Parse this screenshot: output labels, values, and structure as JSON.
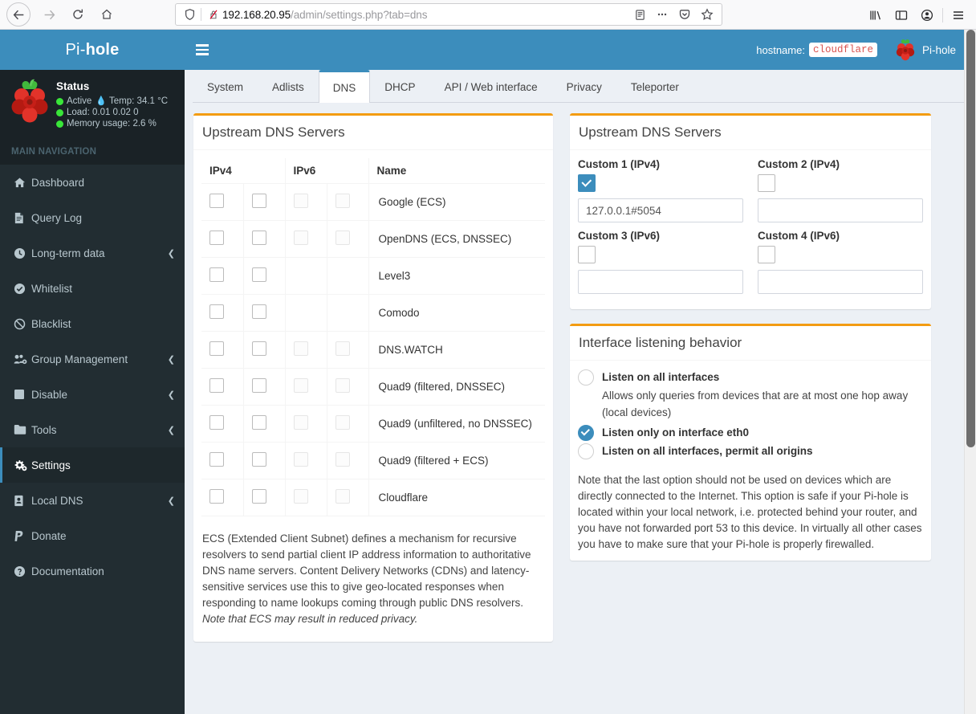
{
  "browser": {
    "back_icon": "back-arrow-icon",
    "forward_icon": "forward-arrow-icon",
    "reload_icon": "reload-icon",
    "home_icon": "home-icon",
    "shield_icon": "shield-icon",
    "insecure_icon": "broken-lock-icon",
    "url_host": "192.168.20.95",
    "url_path": "/admin/settings.php?tab=dns",
    "reader_icon": "reader-view-icon",
    "page_actions_icon": "ellipsis-icon",
    "pocket_icon": "pocket-icon",
    "bookmark_icon": "star-icon",
    "library_icon": "library-icon",
    "sidebar_icon": "sidebar-icon",
    "account_icon": "account-icon",
    "menu_icon": "hamburger-menu-icon"
  },
  "sidebar": {
    "brand_light": "Pi-",
    "brand_bold": "hole",
    "status": {
      "title": "Status",
      "active": "Active",
      "temp": "Temp: 34.1 °C",
      "load": "Load:  0.01  0.02  0",
      "memory": "Memory usage:  2.6 %"
    },
    "nav_header": "MAIN NAVIGATION",
    "items": [
      {
        "label": "Dashboard",
        "icon": "home-icon",
        "chevron": false,
        "active": false
      },
      {
        "label": "Query Log",
        "icon": "file-icon",
        "chevron": false,
        "active": false
      },
      {
        "label": "Long-term data",
        "icon": "clock-icon",
        "chevron": true,
        "active": false
      },
      {
        "label": "Whitelist",
        "icon": "check-circle-icon",
        "chevron": false,
        "active": false
      },
      {
        "label": "Blacklist",
        "icon": "ban-icon",
        "chevron": false,
        "active": false
      },
      {
        "label": "Group Management",
        "icon": "users-gear-icon",
        "chevron": true,
        "active": false
      },
      {
        "label": "Disable",
        "icon": "square-icon",
        "chevron": true,
        "active": false
      },
      {
        "label": "Tools",
        "icon": "folder-icon",
        "chevron": true,
        "active": false
      },
      {
        "label": "Settings",
        "icon": "gears-icon",
        "chevron": false,
        "active": true
      },
      {
        "label": "Local DNS",
        "icon": "address-book-icon",
        "chevron": true,
        "active": false
      },
      {
        "label": "Donate",
        "icon": "paypal-icon",
        "chevron": false,
        "active": false
      },
      {
        "label": "Documentation",
        "icon": "question-circle-icon",
        "chevron": false,
        "active": false
      }
    ],
    "chevron_glyph": "❮"
  },
  "topbar": {
    "menu_icon": "hamburger-menu-icon",
    "hostname_label": "hostname:",
    "hostname_value": "cloudflare",
    "user_name": "Pi-hole",
    "user_icon": "pihole-logo-icon"
  },
  "tabs": [
    {
      "label": "System",
      "active": false
    },
    {
      "label": "Adlists",
      "active": false
    },
    {
      "label": "DNS",
      "active": true
    },
    {
      "label": "DHCP",
      "active": false
    },
    {
      "label": "API / Web interface",
      "active": false
    },
    {
      "label": "Privacy",
      "active": false
    },
    {
      "label": "Teleporter",
      "active": false
    }
  ],
  "upstream_table": {
    "title": "Upstream DNS Servers",
    "headers": {
      "ipv4": "IPv4",
      "ipv6": "IPv6",
      "name": "Name"
    },
    "rows": [
      {
        "name": "Google (ECS)",
        "v4a": false,
        "v4b": false,
        "v6a": false,
        "v6b": false,
        "has_v6": true
      },
      {
        "name": "OpenDNS (ECS, DNSSEC)",
        "v4a": false,
        "v4b": false,
        "v6a": false,
        "v6b": false,
        "has_v6": true
      },
      {
        "name": "Level3",
        "v4a": false,
        "v4b": false,
        "v6a": false,
        "v6b": false,
        "has_v6": false
      },
      {
        "name": "Comodo",
        "v4a": false,
        "v4b": false,
        "v6a": false,
        "v6b": false,
        "has_v6": false
      },
      {
        "name": "DNS.WATCH",
        "v4a": false,
        "v4b": false,
        "v6a": false,
        "v6b": false,
        "has_v6": true
      },
      {
        "name": "Quad9 (filtered, DNSSEC)",
        "v4a": false,
        "v4b": false,
        "v6a": false,
        "v6b": false,
        "has_v6": true
      },
      {
        "name": "Quad9 (unfiltered, no DNSSEC)",
        "v4a": false,
        "v4b": false,
        "v6a": false,
        "v6b": false,
        "has_v6": true
      },
      {
        "name": "Quad9 (filtered + ECS)",
        "v4a": false,
        "v4b": false,
        "v6a": false,
        "v6b": false,
        "has_v6": true
      },
      {
        "name": "Cloudflare",
        "v4a": false,
        "v4b": false,
        "v6a": false,
        "v6b": false,
        "has_v6": true
      }
    ],
    "ecs_note_main": "ECS (Extended Client Subnet) defines a mechanism for recursive resolvers to send partial client IP address information to authoritative DNS name servers. Content Delivery Networks (CDNs) and latency-sensitive services use this to give geo-located responses when responding to name lookups coming through public DNS resolvers. ",
    "ecs_note_italic": "Note that ECS may result in reduced privacy."
  },
  "custom_upstream": {
    "title": "Upstream DNS Servers",
    "fields": [
      {
        "label": "Custom 1 (IPv4)",
        "checked": true,
        "value": "127.0.0.1#5054"
      },
      {
        "label": "Custom 2 (IPv4)",
        "checked": false,
        "value": ""
      },
      {
        "label": "Custom 3 (IPv6)",
        "checked": false,
        "value": ""
      },
      {
        "label": "Custom 4 (IPv6)",
        "checked": false,
        "value": ""
      }
    ]
  },
  "interface_behavior": {
    "title": "Interface listening behavior",
    "options": [
      {
        "label": "Listen on all interfaces",
        "desc": "Allows only queries from devices that are at most one hop away (local devices)",
        "checked": false
      },
      {
        "label": "Listen only on interface eth0",
        "desc": "",
        "checked": true
      },
      {
        "label": "Listen on all interfaces, permit all origins",
        "desc": "",
        "checked": false
      }
    ],
    "note": "Note that the last option should not be used on devices which are directly connected to the Internet. This option is safe if your Pi-hole is located within your local network, i.e. protected behind your router, and you have not forwarded port 53 to this device. In virtually all other cases you have to make sure that your Pi-hole is properly firewalled."
  },
  "colors": {
    "brand_blue": "#3c8dbc",
    "sidebar_dark": "#222d32",
    "accent_orange": "#f39c12",
    "status_green": "#39e639",
    "hostname_red": "#d9534f"
  }
}
